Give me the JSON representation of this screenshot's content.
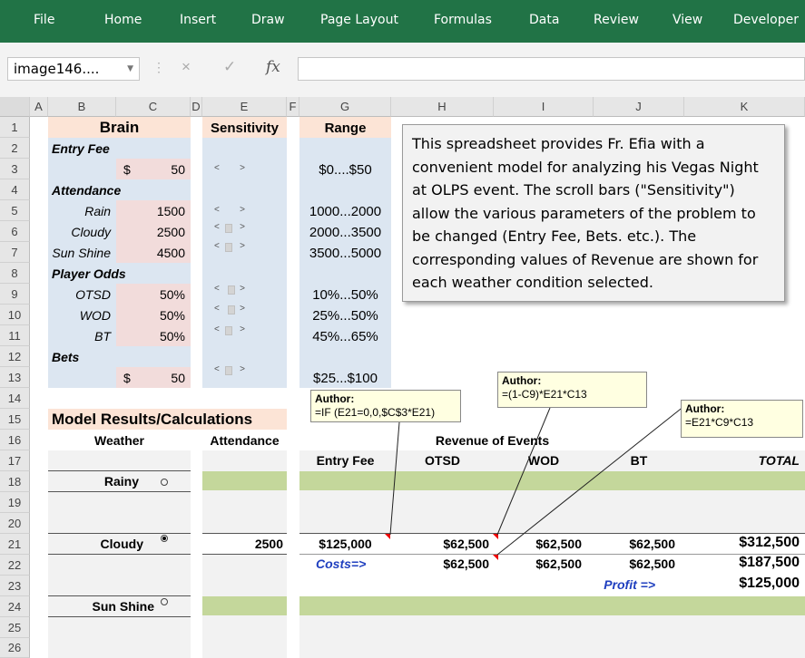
{
  "ribbon": {
    "tabs": [
      "File",
      "Home",
      "Insert",
      "Draw",
      "Page Layout",
      "Formulas",
      "Data",
      "Review",
      "View",
      "Developer"
    ]
  },
  "formula_bar": {
    "name_box": "image146....",
    "cancel_icon": "×",
    "enter_icon": "✓",
    "fx_icon": "fx",
    "content": ""
  },
  "columns": [
    "A",
    "B",
    "C",
    "D",
    "E",
    "F",
    "G",
    "H",
    "I",
    "J",
    "K"
  ],
  "rows": [
    "1",
    "2",
    "3",
    "4",
    "5",
    "6",
    "7",
    "8",
    "9",
    "10",
    "11",
    "12",
    "13",
    "14",
    "15",
    "16",
    "17",
    "18",
    "19",
    "20",
    "21",
    "22",
    "23",
    "24",
    "25",
    "26"
  ],
  "brain": {
    "title": "Brain",
    "entry_fee_label": "Entry Fee",
    "entry_fee_currency": "$",
    "entry_fee_value": "50",
    "attendance_label": "Attendance",
    "rain_label": "Rain",
    "rain_value": "1500",
    "cloudy_label": "Cloudy",
    "cloudy_value": "2500",
    "sunshine_label": "Sun Shine",
    "sunshine_value": "4500",
    "player_odds_label": "Player Odds",
    "otsd_label": "OTSD",
    "otsd_value": "50%",
    "wod_label": "WOD",
    "wod_value": "50%",
    "bt_label": "BT",
    "bt_value": "50%",
    "bets_label": "Bets",
    "bets_currency": "$",
    "bets_value": "50"
  },
  "sensitivity": {
    "title": "Sensitivity",
    "left_arrow": "<",
    "right_arrow": ">"
  },
  "range": {
    "title": "Range",
    "entry_fee": "$0....$50",
    "rain": "1000...2000",
    "cloudy": "2000...3500",
    "sunshine": "3500...5000",
    "otsd": "10%...50%",
    "wod": "25%...50%",
    "bt": "45%...65%",
    "bets": "$25...$100"
  },
  "description": "This spreadsheet provides Fr. Efia with a convenient model for analyzing his Vegas Night at OLPS event.  The scroll bars (\"Sensitivity\") allow the various parameters of the problem to be changed (Entry Fee, Bets. etc.).  The corresponding values of Revenue are shown for each weather condition selected.",
  "model": {
    "title": "Model Results/Calculations",
    "weather_header": "Weather",
    "attendance_header": "Attendance",
    "revenue_header": "Revenue of Events",
    "col_entry_fee": "Entry Fee",
    "col_otsd": "OTSD",
    "col_wod": "WOD",
    "col_bt": "BT",
    "col_total": "TOTAL",
    "rainy_label": "Rainy",
    "cloudy_label": "Cloudy",
    "sunshine_label": "Sun Shine",
    "cloudy_attendance": "2500",
    "cloudy_entry_fee": "$125,000",
    "cloudy_otsd": "$62,500",
    "cloudy_wod": "$62,500",
    "cloudy_bt": "$62,500",
    "cloudy_total": "$312,500",
    "costs_label": "Costs=>",
    "costs_otsd": "$62,500",
    "costs_wod": "$62,500",
    "costs_bt": "$62,500",
    "costs_total": "$187,500",
    "profit_label": "Profit =>",
    "profit_value": "$125,000"
  },
  "comments": {
    "c1_author": "Author:",
    "c1_text": "=IF (E21=0,0,$C$3*E21)",
    "c2_author": "Author:",
    "c2_text": "=(1-C9)*E21*C13",
    "c3_author": "Author:",
    "c3_text": "=E21*C9*C13"
  },
  "colors": {
    "ribbon": "#217346",
    "brain_bg": "#dce6f1",
    "value_bg": "#f2dcdb",
    "title_bg": "#fce4d6",
    "green_band": "#c4d79b",
    "costs_blue": "#1f3fbf"
  }
}
